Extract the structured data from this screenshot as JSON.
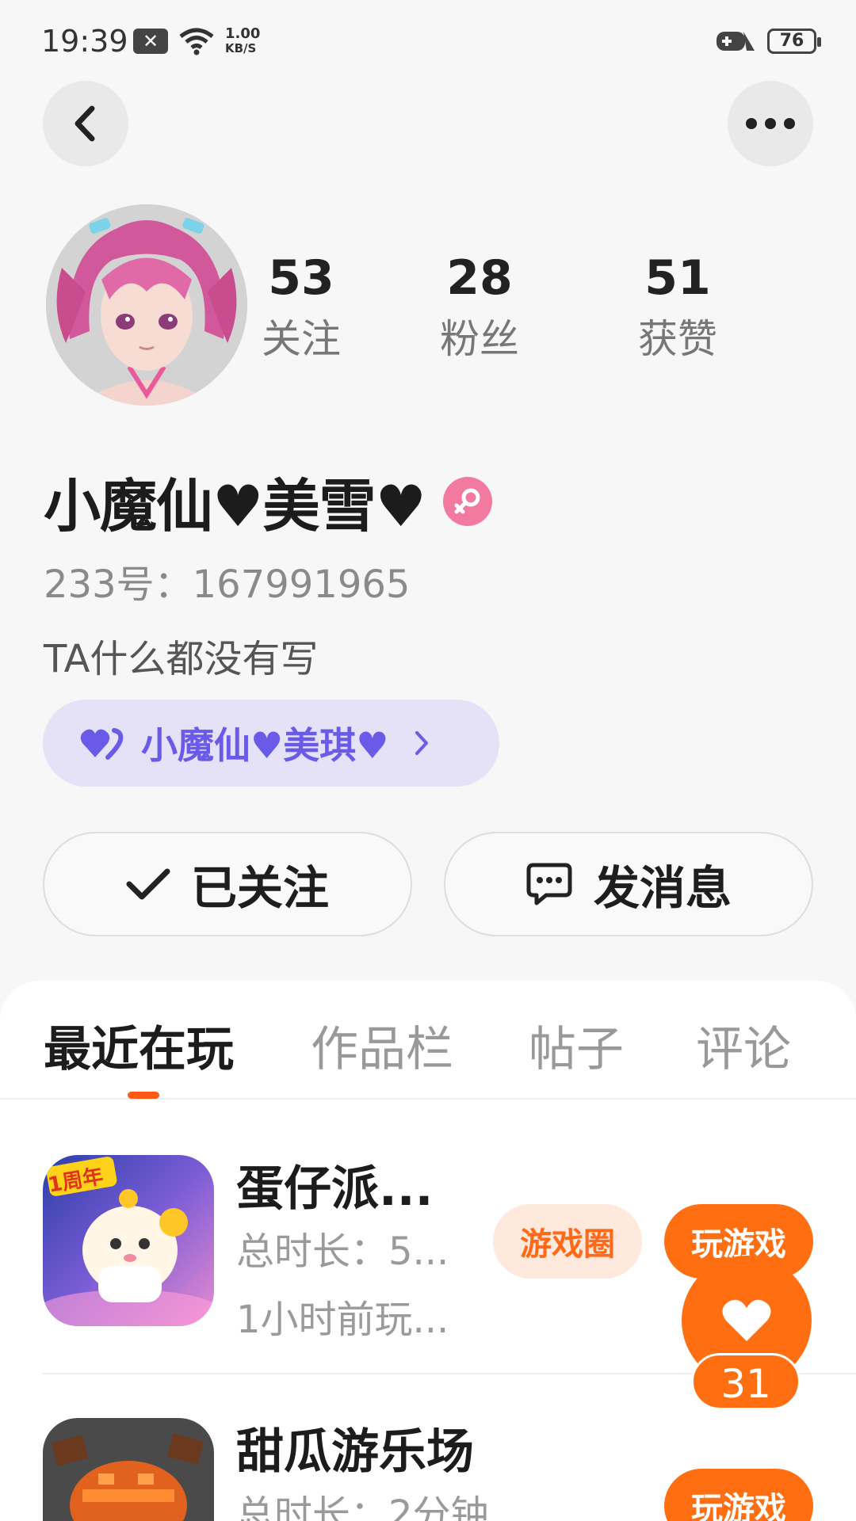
{
  "status_bar": {
    "time": "19:39",
    "net_speed_value": "1.00",
    "net_speed_unit": "KB/S",
    "battery": "76"
  },
  "header": {
    "back_icon": "chevron-left-icon",
    "more_icon": "more-dots-icon"
  },
  "profile": {
    "stats": [
      {
        "value": "53",
        "label": "关注"
      },
      {
        "value": "28",
        "label": "粉丝"
      },
      {
        "value": "51",
        "label": "获赞"
      }
    ],
    "nickname": "小魔仙♥美雪♥",
    "gender_icon": "female-icon",
    "uid": "233号：167991965",
    "bio": "TA什么都没有写",
    "cp": {
      "name": "小魔仙♥美琪♥",
      "icon": "double-heart-icon"
    }
  },
  "actions": {
    "follow_label": "已关注",
    "message_label": "发消息"
  },
  "tabs": [
    "最近在玩",
    "作品栏",
    "帖子",
    "评论"
  ],
  "games": [
    {
      "title": "蛋仔派...",
      "duration": "总时长：5...",
      "last_played": "1小时前玩...",
      "circle_label": "游戏圈",
      "play_label": "玩游戏",
      "icon_badge": "1周年"
    },
    {
      "title": "甜瓜游乐场",
      "duration": "总时长：2分钟",
      "play_label": "玩游戏"
    }
  ],
  "like_fab": {
    "count": "31",
    "icon": "heart-icon"
  },
  "colors": {
    "accent": "#ff6f12",
    "cp_text": "#6a5ae8",
    "gender": "#f27aa0"
  }
}
